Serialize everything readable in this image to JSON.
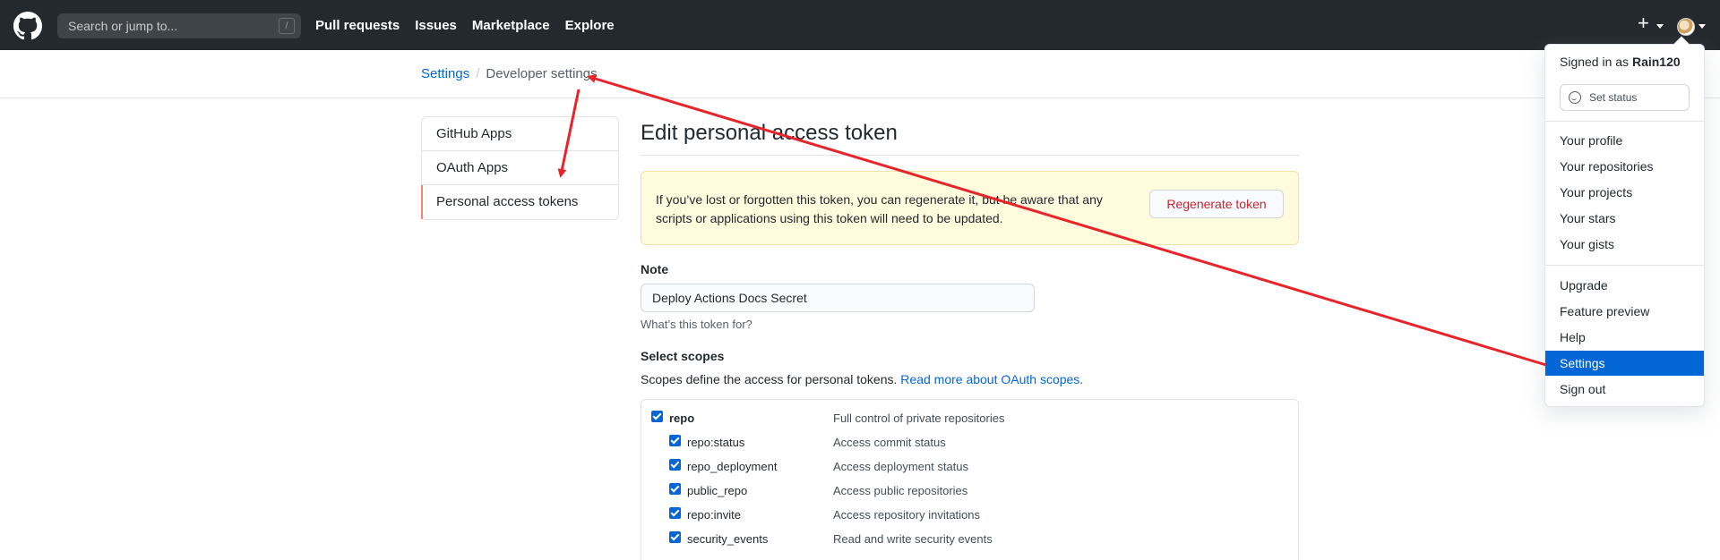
{
  "header": {
    "search_placeholder": "Search or jump to...",
    "search_shortcut": "/",
    "nav": [
      "Pull requests",
      "Issues",
      "Marketplace",
      "Explore"
    ],
    "plus": "+"
  },
  "breadcrumb": {
    "settings": "Settings",
    "separator": "/",
    "current": "Developer settings"
  },
  "sidebar": {
    "items": [
      "GitHub Apps",
      "OAuth Apps",
      "Personal access tokens"
    ],
    "selected_index": 2
  },
  "main": {
    "title": "Edit personal access token",
    "flash_text": "If you’ve lost or forgotten this token, you can regenerate it, but be aware that any scripts or applications using this token will need to be updated.",
    "regenerate_label": "Regenerate token",
    "note_label": "Note",
    "note_value": "Deploy Actions Docs Secret",
    "note_help": "What’s this token for?",
    "scopes_label": "Select scopes",
    "scopes_desc": "Scopes define the access for personal tokens.",
    "scopes_link": "Read more about OAuth scopes.",
    "scopes": [
      {
        "name": "repo",
        "desc": "Full control of private repositories",
        "checked": true
      },
      {
        "name": "repo:status",
        "desc": "Access commit status",
        "checked": true
      },
      {
        "name": "repo_deployment",
        "desc": "Access deployment status",
        "checked": true
      },
      {
        "name": "public_repo",
        "desc": "Access public repositories",
        "checked": true
      },
      {
        "name": "repo:invite",
        "desc": "Access repository invitations",
        "checked": true
      },
      {
        "name": "security_events",
        "desc": "Read and write security events",
        "checked": true
      }
    ]
  },
  "dropdown": {
    "signed_in_prefix": "Signed in as",
    "username": "Rain120",
    "set_status": "Set status",
    "items": [
      "Your profile",
      "Your repositories",
      "Your projects",
      "Your stars",
      "Your gists",
      "Upgrade",
      "Feature preview",
      "Help",
      "Settings",
      "Sign out"
    ],
    "active_item": "Settings"
  },
  "colors": {
    "header_bg": "#24292e",
    "link": "#0366d6",
    "annotation_arrow": "#e8242a",
    "flash_bg": "#fffbdd",
    "danger": "#cb2431"
  }
}
